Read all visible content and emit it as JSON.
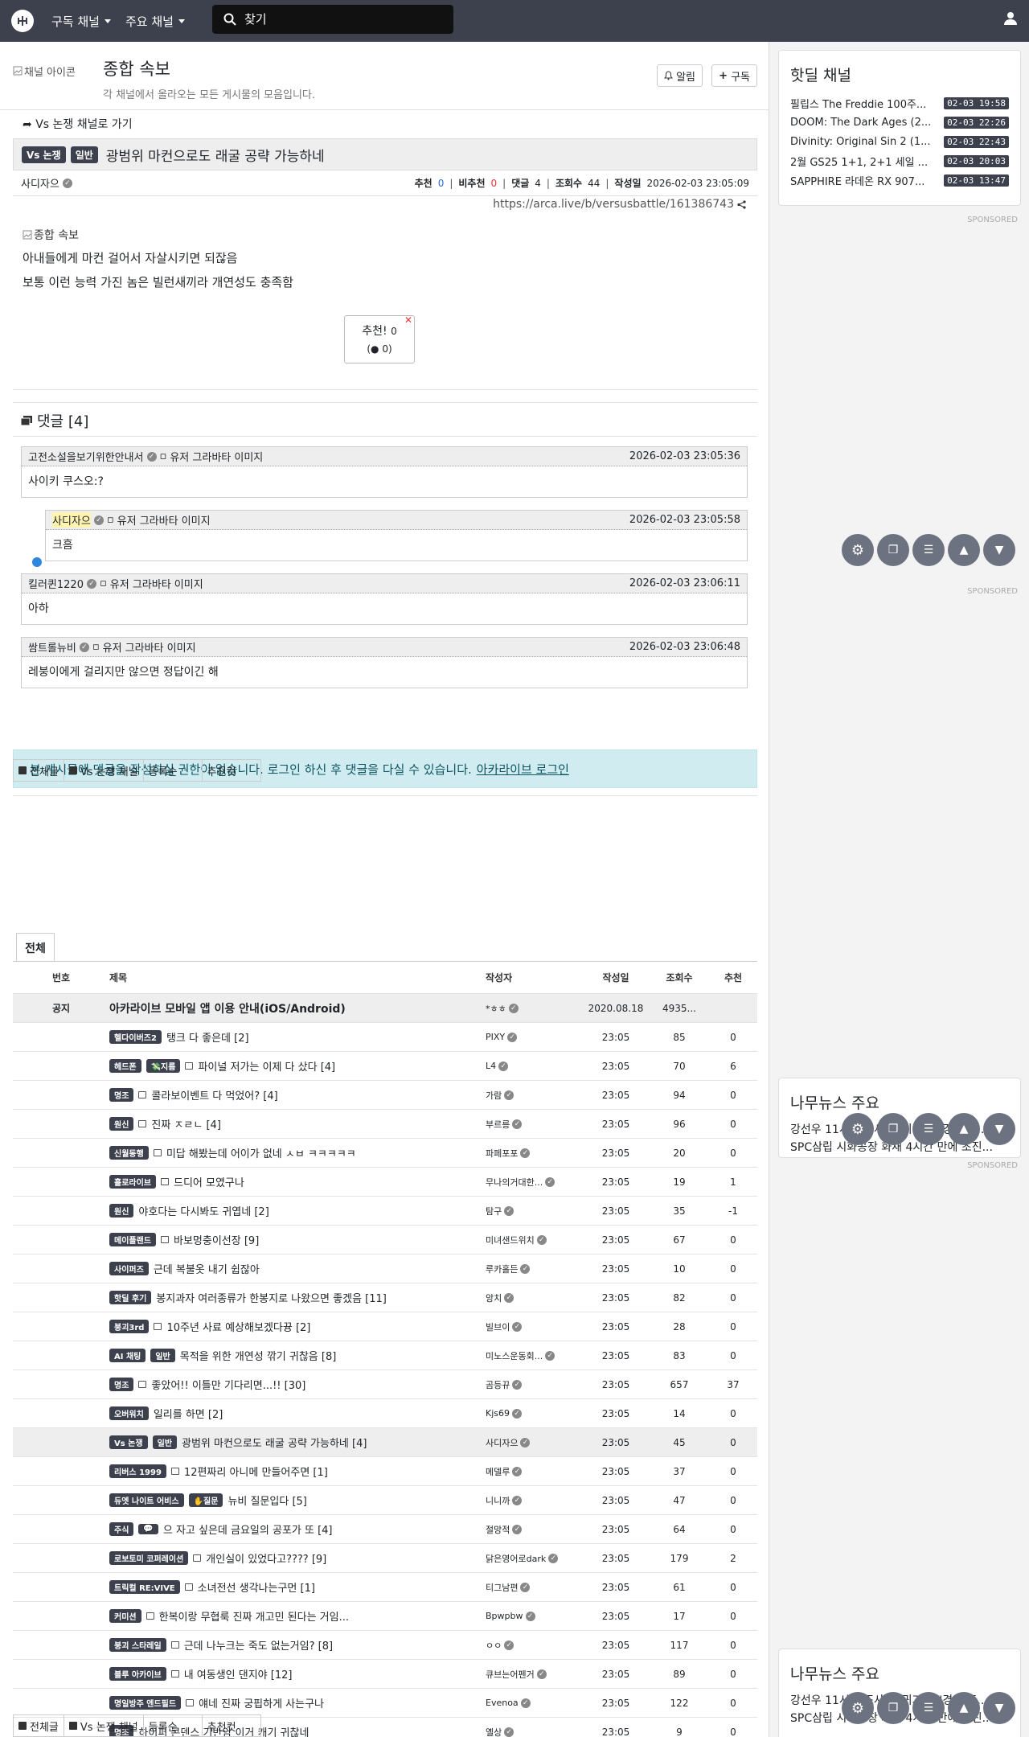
{
  "nav": {
    "menu_subscribed": "구독 채널",
    "menu_main": "주요 채널",
    "search_placeholder": "찾기"
  },
  "channel": {
    "image_alt": "채널 아이콘",
    "title": "종합 속보",
    "description": "각 채널에서 올라오는 모든 게시물의 모음입니다.",
    "alert_label": "알림",
    "subscribe_label": "구독"
  },
  "article": {
    "goto_label": "Vs 논쟁 채널로 가기",
    "badge_channel": "Vs 논쟁",
    "badge_category": "일반",
    "title": "광범위 마컨으로도 래굴 공략 가능하네",
    "author": "사디자으",
    "rec_label": "추천",
    "rec": "0",
    "nonrec_label": "비추천",
    "nonrec": "0",
    "comments_label": "댓글",
    "comments": "4",
    "views_label": "조회수",
    "views": "44",
    "date_label": "작성일",
    "date": "2026-02-03 23:05:09",
    "url": "https://arca.live/b/versusbattle/161386743",
    "image_alt": "종합 속보",
    "line1": "아내들에게 마컨 걸어서 자살시키면 되잖음",
    "line2": "보통 이런 능력 가진 놈은 빌런새끼라 개연성도 충족함",
    "vote_label": "추천!",
    "vote_count": "0",
    "vote_sub_count": "0"
  },
  "comments": {
    "header": "댓글 [4]",
    "avatar_alt": "유저 그라바타 이미지",
    "items": [
      {
        "author": "고전소설을보기위한안내서",
        "time": "2026-02-03 23:05:36",
        "text": "사이키 쿠스오:?"
      },
      {
        "author": "사디자으",
        "time": "2026-02-03 23:05:58",
        "text": "크흠"
      },
      {
        "author": "킬러퀸1220",
        "time": "2026-02-03 23:06:11",
        "text": "아하"
      },
      {
        "author": "쌈트롤뉴비",
        "time": "2026-02-03 23:06:48",
        "text": "레붕이에게 걸리지만 않으면 정답이긴 해"
      }
    ]
  },
  "notice": {
    "text": "본 게시물에 댓글을 작성하실 권한이 없습니다. 로그인 하신 후 댓글을 다실 수 있습니다.",
    "link": "아카라이브 로그인"
  },
  "tabs": {
    "all_posts": "전체글",
    "channel": "Vs 논쟁 채널",
    "sort_reg": "등록순",
    "sort_rec": "추천컷"
  },
  "board": {
    "tab_all": "전체",
    "headers": {
      "no": "번호",
      "title": "제목",
      "author": "작성자",
      "date": "작성일",
      "views": "조회수",
      "rec": "추천"
    },
    "notice_row": {
      "no": "공지",
      "title": "아카라이브 모바일 앱 이용 안내(iOS/Android)",
      "author": "*ㅎㅎ",
      "date": "2020.08.18",
      "views": "4935...",
      "rec": ""
    },
    "rows": [
      {
        "badges": [
          "헬다이버즈2"
        ],
        "title": "탱크 다 좋은데 [2]",
        "author": "PIXY",
        "date": "23:05",
        "views": "85",
        "rec": "0",
        "icon": false
      },
      {
        "badges": [
          "헤드폰",
          "💸지름"
        ],
        "title": "파이널 저가는 이제 다 샀다 [4]",
        "author": "L4",
        "date": "23:05",
        "views": "70",
        "rec": "6",
        "icon": true
      },
      {
        "badges": [
          "명조"
        ],
        "title": "콜라보이벤트 다 먹었어? [4]",
        "author": "가람",
        "date": "23:05",
        "views": "94",
        "rec": "0",
        "icon": true
      },
      {
        "badges": [
          "원신"
        ],
        "title": "진짜 ㅈㄹㄴ [4]",
        "author": "부르릉",
        "date": "23:05",
        "views": "96",
        "rec": "0",
        "icon": true
      },
      {
        "badges": [
          "신월동행"
        ],
        "title": "미답 해봤는데 어이가 없네 ㅅㅂ ㅋㅋㅋㅋㅋ",
        "author": "파페포포",
        "date": "23:05",
        "views": "20",
        "rec": "0",
        "icon": true
      },
      {
        "badges": [
          "홀로라이브"
        ],
        "title": "드디어 모였구나",
        "author": "무나의거대한...",
        "date": "23:05",
        "views": "19",
        "rec": "1",
        "icon": true
      },
      {
        "badges": [
          "원신"
        ],
        "title": "야호다는 다시봐도 귀엽네 [2]",
        "author": "탐구",
        "date": "23:05",
        "views": "35",
        "rec": "-1",
        "icon": false
      },
      {
        "badges": [
          "메이플랜드"
        ],
        "title": "바보멍충이선장 [9]",
        "author": "미녀샌드위치",
        "date": "23:05",
        "views": "67",
        "rec": "0",
        "icon": true
      },
      {
        "badges": [
          "사이퍼즈"
        ],
        "title": "근데 복불옷 내기 쉽잖아",
        "author": "루카홀든",
        "date": "23:05",
        "views": "10",
        "rec": "0",
        "icon": false
      },
      {
        "badges": [
          "핫딜 후기"
        ],
        "title": "봉지과자 여러종류가 한봉지로 나왔으면 좋겠음 [11]",
        "author": "앙치",
        "date": "23:05",
        "views": "82",
        "rec": "0",
        "icon": false
      },
      {
        "badges": [
          "붕괴3rd"
        ],
        "title": "10주년 사료 예상해보겠다뀽 [2]",
        "author": "빌브이",
        "date": "23:05",
        "views": "28",
        "rec": "0",
        "icon": true
      },
      {
        "badges": [
          "AI 채팅",
          "일반"
        ],
        "title": "목적을 위한 개연성 깎기 귀찮음 [8]",
        "author": "미노스운동회...",
        "date": "23:05",
        "views": "83",
        "rec": "0",
        "icon": false
      },
      {
        "badges": [
          "명조"
        ],
        "title": "좋았어!! 이틀만 기다리면...!! [30]",
        "author": "곰등뀨",
        "date": "23:05",
        "views": "657",
        "rec": "37",
        "icon": true
      },
      {
        "badges": [
          "오버워치"
        ],
        "title": "일리를 하면 [2]",
        "author": "Kjs69",
        "date": "23:05",
        "views": "14",
        "rec": "0",
        "icon": false
      },
      {
        "badges": [
          "Vs 논쟁",
          "일반"
        ],
        "title": "광범위 마컨으로도 래굴 공략 가능하네 [4]",
        "author": "사디자으",
        "date": "23:05",
        "views": "45",
        "rec": "0",
        "icon": false,
        "hl": true
      },
      {
        "badges": [
          "리버스 1999"
        ],
        "title": "12편짜리 아니메 만들어주면 [1]",
        "author": "메델루",
        "date": "23:05",
        "views": "37",
        "rec": "0",
        "icon": true
      },
      {
        "badges": [
          "듀엣 나이트 어비스",
          "✋질문"
        ],
        "title": "뉴비 질문입다 [5]",
        "author": "니니까",
        "date": "23:05",
        "views": "47",
        "rec": "0",
        "icon": false
      },
      {
        "badges": [
          "주식",
          "💬"
        ],
        "title": "으 자고 싶은데 금요일의 공포가 또 [4]",
        "author": "절망적",
        "date": "23:05",
        "views": "64",
        "rec": "0",
        "icon": false
      },
      {
        "badges": [
          "로보토미 코퍼레이션"
        ],
        "title": "개인실이 있었다고???? [9]",
        "author": "닭은영어로dark",
        "date": "23:05",
        "views": "179",
        "rec": "2",
        "icon": true
      },
      {
        "badges": [
          "트릭컬 RE:VIVE"
        ],
        "title": "소녀전선 생각나는구먼 [1]",
        "author": "티그남편",
        "date": "23:05",
        "views": "61",
        "rec": "0",
        "icon": true
      },
      {
        "badges": [
          "커미션"
        ],
        "title": "한복이랑 무협룩 진짜 개고민 된다는 거임...",
        "author": "Bpwpbw",
        "date": "23:05",
        "views": "17",
        "rec": "0",
        "icon": true
      },
      {
        "badges": [
          "붕괴 스타레일"
        ],
        "title": "근데 나누크는 죽도 없는거임? [8]",
        "author": "ㅇㅇ",
        "date": "23:05",
        "views": "117",
        "rec": "0",
        "icon": true
      },
      {
        "badges": [
          "블루 아카이브"
        ],
        "title": "내 여동생인 댄지야 [12]",
        "author": "큐브는어펜거",
        "date": "23:05",
        "views": "89",
        "rec": "0",
        "icon": true
      },
      {
        "badges": [
          "명일방주 엔드필드"
        ],
        "title": "얘네 진짜 궁핍하게 사는구나",
        "author": "Evenoa",
        "date": "23:05",
        "views": "122",
        "rec": "0",
        "icon": true
      },
      {
        "badges": [
          "명조"
        ],
        "title": "하이퍼 콘덴스 기반암 이거 캐기 귀찮네",
        "author": "옐상",
        "date": "23:05",
        "views": "9",
        "rec": "0",
        "icon": false
      }
    ]
  },
  "sidebar": {
    "hotdeal_title": "핫딜 채널",
    "hotdeals": [
      {
        "title": "필립스 The Freddie 100주...",
        "time": "02-03 19:58"
      },
      {
        "title": "DOOM: The Dark Ages (2...",
        "time": "02-03 22:26"
      },
      {
        "title": "Divinity: Original Sin 2 (1...",
        "time": "02-03 22:43"
      },
      {
        "title": "2월 GS25 1+1, 2+1 세일 ...",
        "time": "02-03 20:03"
      },
      {
        "title": "SAPPHIRE 라데온 RX 907...",
        "time": "02-03 13:47"
      }
    ],
    "sponsored": "SPONSORED",
    "news_title": "나무뉴스 주요",
    "news": [
      "강선우 11시간 조사 후 귀가… \"경찰 조...",
      "SPC삼립 시화공장 화재 4시간 만에 초진..."
    ]
  },
  "colors": {
    "navbar": "#3d414d",
    "badge": "#3d414d",
    "notice_bg": "#d1ecf1",
    "rec_blue": "#2e6cd4",
    "nonrec_red": "#e33"
  }
}
